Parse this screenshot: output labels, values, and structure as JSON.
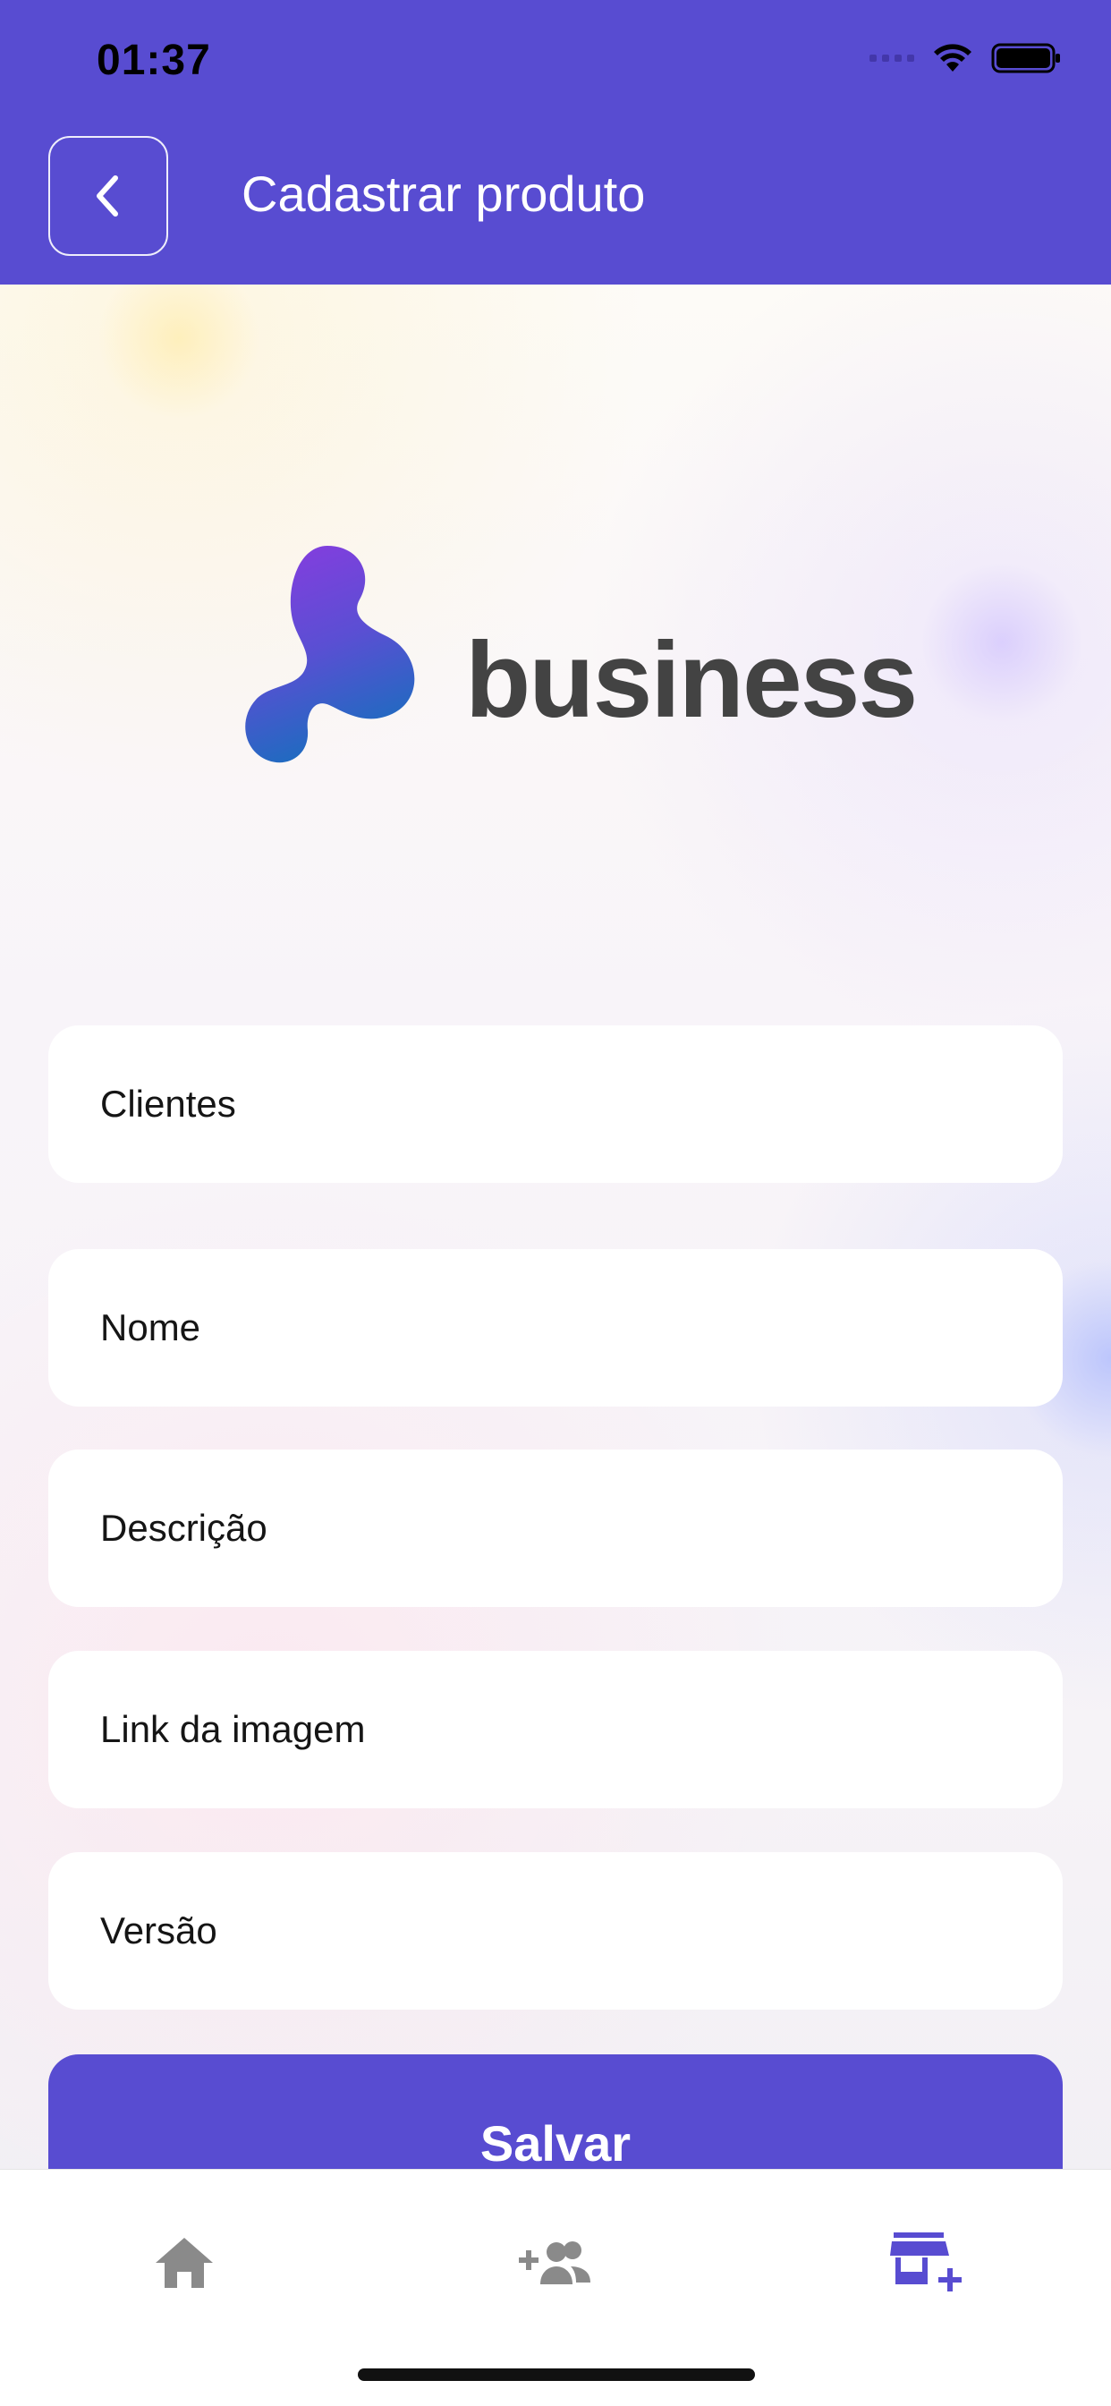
{
  "status_bar": {
    "time": "01:37"
  },
  "header": {
    "title": "Cadastrar produto",
    "back_icon": "chevron-left-icon"
  },
  "logo": {
    "text": "business"
  },
  "form": {
    "clientes_placeholder": "Clientes",
    "nome_placeholder": "Nome",
    "descricao_placeholder": "Descrição",
    "link_placeholder": "Link da imagem",
    "versao_placeholder": "Versão",
    "save_label": "Salvar"
  },
  "tabs": [
    {
      "icon": "home-icon",
      "active": false
    },
    {
      "icon": "add-users-icon",
      "active": false
    },
    {
      "icon": "add-store-icon",
      "active": true
    }
  ],
  "colors": {
    "primary": "#584cd1",
    "inactive_tab": "#8a8a8a",
    "logo_text": "#434343"
  }
}
